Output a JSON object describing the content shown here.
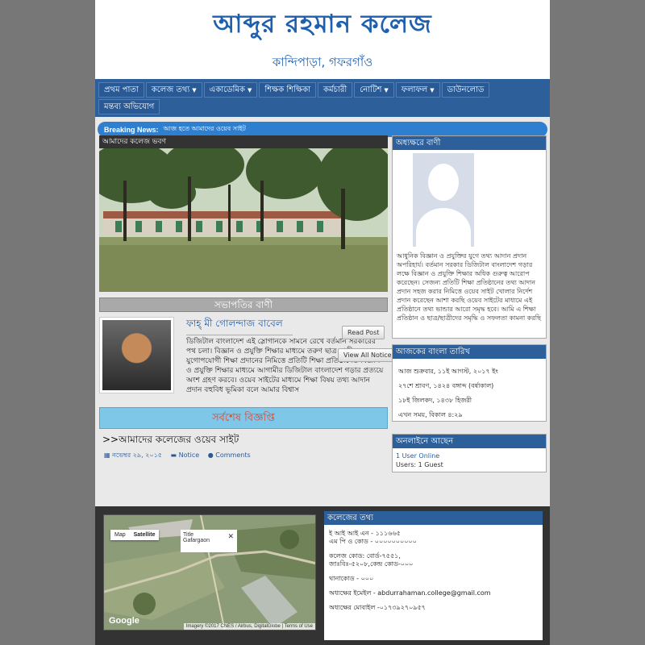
{
  "header": {
    "title": "আব্দুর রহমান কলেজ",
    "subtitle": "কান্দিপাড়া, গফরগাঁও"
  },
  "nav": [
    {
      "label": "প্রথম পাতা",
      "dropdown": false
    },
    {
      "label": "কলেজ তথ্য",
      "dropdown": true
    },
    {
      "label": "একাডেমিক",
      "dropdown": true
    },
    {
      "label": "শিক্ষক শিক্ষিকা",
      "dropdown": false
    },
    {
      "label": "কর্মচারী",
      "dropdown": false
    },
    {
      "label": "নোটিশ",
      "dropdown": true
    },
    {
      "label": "ফলাফল",
      "dropdown": true
    },
    {
      "label": "ডাউনলোড",
      "dropdown": false
    },
    {
      "label": "মন্তব্য অভিযোগ",
      "dropdown": false
    }
  ],
  "breaking": {
    "label": "Breaking News:",
    "text": "আজ হতে আমাদের ওয়েব সাইট"
  },
  "main": {
    "photo_caption": "আমাদের কলেজ ভবণ",
    "president_heading": "সভাপতির বাণী",
    "president_name": "ফাহ্‌ মী গোলন্দাজ বাবেল",
    "president_text": "ডিজিটাল বাংলাদেশ এই স্লোগানকে সামনে রেখে বর্তমান সরকারের পথ চলা। বিজ্ঞান ও প্রযুক্তি শিক্ষার মাধ্যমে তরুণ ছাত্র ছাত্রী যুগোপযোগী শিক্ষা প্রদানের নিমিত্তে প্রতিটি শিক্ষা প্রতিষ্ঠানেও বিজ্ঞান ও প্রযুক্তি শিক্ষার মাধ্যমে আগামীর ডিজিটাল বাংলাদেশ গড়ার প্রত্যয়ে অংশ গ্রহণ করবে। ওয়েব সাইটের মাধ্যমে শিক্ষা বিষয় তথ্য আদান প্রদান বহুবিধ ভূমিকা বলে আমার বিশ্বাস",
    "notice_heading": "সর্বশেষ বিজ্ঞপ্তি",
    "notice_title": ">>আমাদের কলেজের ওয়েব সাইট",
    "notice_date": "নভেম্বর ২৯, ২০১৫",
    "notice_category": "Notice",
    "notice_comments": "Comments",
    "read_post": "Read Post",
    "view_all": "View All Notice"
  },
  "sidebar": {
    "principal_heading": "অধ্যক্ষরে বাণী",
    "principal_text": "আধুনিক বিজ্ঞান ও প্রযুক্তির যুগে তথ্য আদান প্রদান অপরিহার্য। বর্তমান সরকার ডিজিটাল বাংলাদেশ গড়ার লক্ষে বিজ্ঞান ও প্রযুক্তি শিক্ষার অধিক গুরুত্ব আরোপ করেছেন। সেজন্য প্রতিটি শিক্ষা প্রতিষ্ঠানের তথ্য আদান প্রদান সহজ করার নিমিত্তে ওয়েব সাইট খোলার নির্দেশ প্রদান করেছেন আশা করছি ওয়েব সাইটের মাধ্যমে এই প্রতিষ্ঠানে তথ্য ভান্ডার আরো সমৃদ্ধ হবে। আমি এ শিক্ষা প্রতিষ্ঠান ও ছাত্র/ছাত্রীদের সমৃদ্ধি ও সফলতা কামনা করছি",
    "date_heading": "আজকের বাংলা তারিখ",
    "date_lines": [
      "আজ শুক্রবার, ১১ই আগস্ট, ২০১৭ ইং",
      "২৭শে শ্রাবণ, ১৪২৪ বঙ্গাব্দ (বর্ষাকাল)",
      "১৮ই জিলকদ, ১৪৩৮ হিজরী",
      "এখন সময়, বিকাল ৪:২৯"
    ],
    "online_heading": "অনলাইনে আছেন",
    "online_line1": "1 User Online",
    "online_line2": "Users: 1 Guest"
  },
  "footer": {
    "map": {
      "tab_map": "Map",
      "tab_sat": "Satellite",
      "popup_title": "Title",
      "popup_sub": "Gafargaon",
      "google": "Google",
      "attribution": "Imagery ©2017 CNES / Airbus, DigitalGlobe | Terms of Use"
    },
    "info_heading": "কলেজের তথ্য",
    "info_lines": [
      "ই আই আই এন - ১১১৬৬৫\nএম পি ও কোড - ০০০০০০০০০০",
      "কলেজ কোড: বোর্ড-৭৫৫১,\nজাঃবিঃ-৫২০৮,কেন্দ্র কোড-০০০",
      "থানাকোড - ০০০",
      "অধ্যক্ষের ইমেইল - abdurrahaman.college@gmail.com",
      "অধ্যক্ষের মোবাইল -০১৭৩৯২৭০৯৫৭"
    ]
  },
  "colors": {
    "brand": "#1e5fae",
    "nav": "#2d5f9a",
    "breaking": "#2f7fd0",
    "notice": "#7fc7e8",
    "notice_text": "#e8432b"
  }
}
